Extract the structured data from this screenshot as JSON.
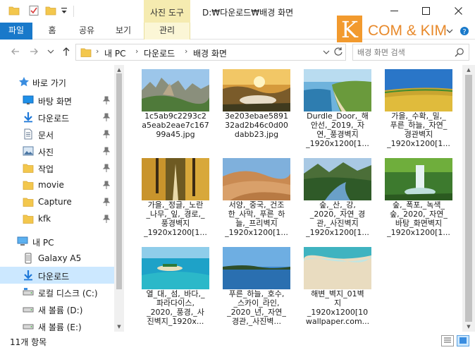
{
  "window": {
    "tool_tab": "사진 도구",
    "title": "D:₩다운로드₩배경 화면"
  },
  "ribbon": {
    "tabs": [
      "파일",
      "홈",
      "공유",
      "보기"
    ],
    "manage": "관리"
  },
  "brand": {
    "k": "K",
    "text": "COM & KIM"
  },
  "address": {
    "crumbs": [
      "내 PC",
      "다운로드",
      "배경 화면"
    ],
    "search_placeholder": "배경 화면 검색"
  },
  "nav": {
    "quick_access": "바로 가기",
    "pinned": [
      {
        "label": "바탕 화면",
        "icon": "desktop-icon"
      },
      {
        "label": "다운로드",
        "icon": "download-icon"
      },
      {
        "label": "문서",
        "icon": "document-icon"
      },
      {
        "label": "사진",
        "icon": "pictures-icon"
      }
    ],
    "folders": [
      {
        "label": "작업",
        "icon": "folder-icon"
      },
      {
        "label": "movie",
        "icon": "folder-icon"
      },
      {
        "label": "Capture",
        "icon": "folder-icon"
      },
      {
        "label": "kfk",
        "icon": "folder-icon"
      }
    ],
    "this_pc": "내 PC",
    "pc_items": [
      {
        "label": "Galaxy A5",
        "icon": "phone-icon"
      },
      {
        "label": "다운로드",
        "icon": "download-icon"
      },
      {
        "label": "로컬 디스크 (C:)",
        "icon": "drive-icon"
      },
      {
        "label": "새 볼륨 (D:)",
        "icon": "drive-icon"
      },
      {
        "label": "새 볼륨 (E:)",
        "icon": "drive-icon"
      }
    ]
  },
  "files": [
    {
      "name": "1c5ab9c2293c2\na5eab2eae7c167\n99a45.jpg",
      "scene": "cliffs"
    },
    {
      "name": "3e203ebae5891\n32ad2b46c0d00\ndabb23.jpg",
      "scene": "sunset-valley"
    },
    {
      "name": "Durdle_Door,_해\n안선,_2019,_자\n연,_풍경벽지\n_1920x1200[1...",
      "scene": "coast"
    },
    {
      "name": "가을,_수확,_밀,_\n푸른_하늘,_자연_\n경관벽지\n_1920x1200[1...",
      "scene": "wheat"
    },
    {
      "name": "가을,_정글,_노란\n_나무,_잎,_경로,_\n풍경벽지\n_1920x1200[1...",
      "scene": "autumn-path"
    },
    {
      "name": "서양,_중국,_건조\n한_사막,_푸른_하\n늘,_프리벽지\n_1920x1200[1...",
      "scene": "desert"
    },
    {
      "name": "숲,_산,_강,\n_2020,_자연_경\n관,_사진벽지\n_1920x1200[1...",
      "scene": "forest-river"
    },
    {
      "name": "숲,_폭포,_녹색_\n숲,_2020,_자연_\n바탕_화면벽지\n_1920x1200[1...",
      "scene": "waterfall"
    },
    {
      "name": "열_대,_섬,_바다,_\n파라다이스,\n_2020,_풍경,_사\n진벽지_1920x...",
      "scene": "tropical"
    },
    {
      "name": "푸른_하늘,_호수,\n_스카이_라인,\n_2020_년,_자연_\n경관,_사진벽...",
      "scene": "lake"
    },
    {
      "name": "해변_벽지_01벽\n지\n_1920x1200[10\nwallpaper.com...",
      "scene": "beach"
    }
  ],
  "status": {
    "count": "11개 항목"
  }
}
